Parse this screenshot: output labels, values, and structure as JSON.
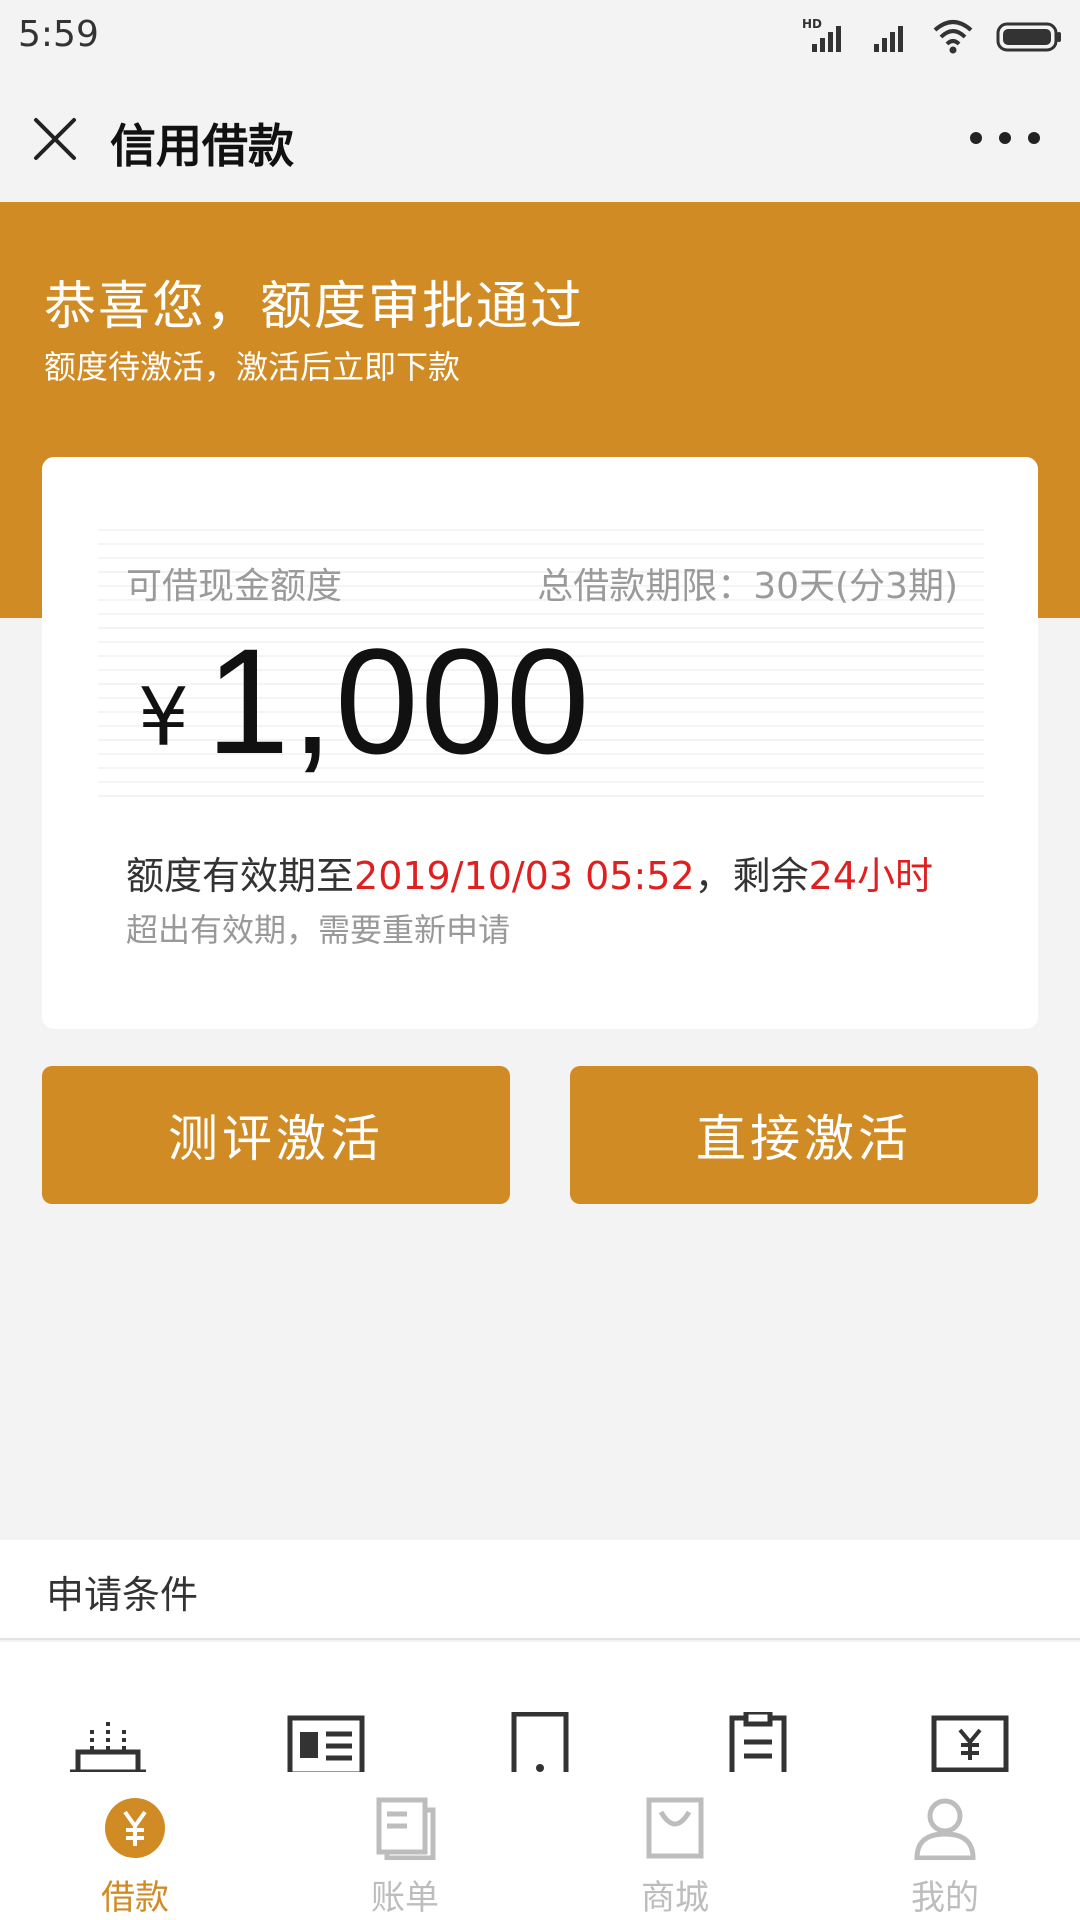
{
  "status_bar": {
    "time": "5:59",
    "network_label": "HD"
  },
  "nav": {
    "title": "信用借款"
  },
  "banner": {
    "headline": "恭喜您，额度审批通过",
    "subline": "额度待激活，激活后立即下款"
  },
  "card": {
    "amount_label": "可借现金额度",
    "term_label": "总借款期限：30天(分3期)",
    "currency": "¥",
    "amount": "1,000",
    "validity_prefix": "额度有效期至",
    "validity_date": "2019/10/03 05:52",
    "validity_mid": "，剩余",
    "validity_remaining": "24小时",
    "hint": "超出有效期，需要重新申请"
  },
  "buttons": {
    "evaluate_label": "测评激活",
    "direct_label": "直接激活"
  },
  "conditions": {
    "title": "申请条件"
  },
  "tabs": [
    {
      "label": "借款",
      "icon": "yen-circle-icon",
      "active": true
    },
    {
      "label": "账单",
      "icon": "bill-icon",
      "active": false
    },
    {
      "label": "商城",
      "icon": "bag-icon",
      "active": false
    },
    {
      "label": "我的",
      "icon": "user-icon",
      "active": false
    }
  ],
  "colors": {
    "accent": "#d08b25",
    "highlight": "#e02020",
    "background": "#f3f3f3"
  }
}
